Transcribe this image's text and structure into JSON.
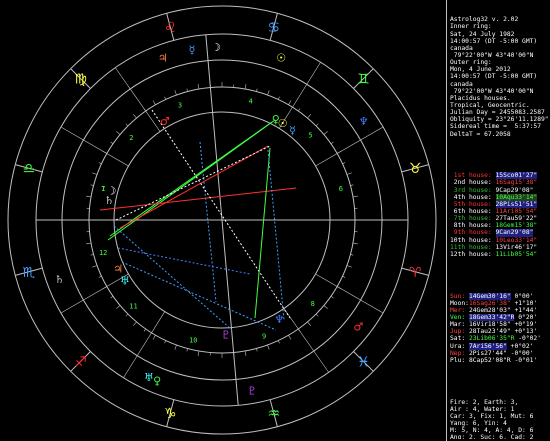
{
  "app": {
    "title": "Astrolog32 v. 2.02"
  },
  "header_lines": [
    {
      "text": "Astrolog32 v. 2.02",
      "color": "#ffffff"
    },
    {
      "text": "Inner ring:",
      "color": "#ffffff"
    },
    {
      "text": "Sat, 24 July 1982",
      "color": "#ffffff"
    },
    {
      "text": "14:00:57 (DT -5:00 GMT)",
      "color": "#ffffff"
    },
    {
      "text": "canada",
      "color": "#ffffff"
    },
    {
      "text": " 79°22'00\"W 43°40'00\"N",
      "color": "#ffffff"
    },
    {
      "text": "Outer ring:",
      "color": "#ffffff"
    },
    {
      "text": "Mon, 4 June 2012",
      "color": "#ffffff"
    },
    {
      "text": "14:00:57 (DT -5:00 GMT)",
      "color": "#ffffff"
    },
    {
      "text": "canada",
      "color": "#ffffff"
    },
    {
      "text": " 79°22'00\"W 43°40'00\"N",
      "color": "#ffffff"
    },
    {
      "text": "Placidus houses.",
      "color": "#ffffff"
    },
    {
      "text": "Tropical, Geocentric.",
      "color": "#ffffff"
    },
    {
      "text": "Julian Day = 2455083.2587",
      "color": "#ffffff"
    },
    {
      "text": "Obliquity = 23°26'11.1289\"",
      "color": "#ffffff"
    },
    {
      "text": "Sidereal time =  5:37:57",
      "color": "#ffffff"
    },
    {
      "text": "DeltaT = 67.2058",
      "color": "#ffffff"
    }
  ],
  "houses": [
    {
      "label": "1st house:",
      "label_color": "#ff3030",
      "value": "15Sco01'27\"",
      "value_color": "#ffffff",
      "bg": "#202080"
    },
    {
      "label": "2nd house:",
      "label_color": "#ffffff",
      "value": "16Sag15'38\"",
      "value_color": "#ff4040",
      "bg": ""
    },
    {
      "label": "3rd house:",
      "label_color": "#30c030",
      "value": "9Cap29'08\"",
      "value_color": "#ffffff",
      "bg": ""
    },
    {
      "label": "4th house:",
      "label_color": "#ffffff",
      "value": "10Aqu33'14\"",
      "value_color": "#40ff40",
      "bg": "#204020"
    },
    {
      "label": "5th house:",
      "label_color": "#ff3030",
      "value": "28Pis51'51\"",
      "value_color": "#ffffff",
      "bg": "#202080"
    },
    {
      "label": "6th house:",
      "label_color": "#ffffff",
      "value": "11Ari05'54\"",
      "value_color": "#ff4040",
      "bg": ""
    },
    {
      "label": "7th house:",
      "label_color": "#30c030",
      "value": "27Tau59'22\"",
      "value_color": "#ffffff",
      "bg": ""
    },
    {
      "label": "8th house:",
      "label_color": "#ffffff",
      "value": "18Gem15'38\"",
      "value_color": "#40ff40",
      "bg": ""
    },
    {
      "label": "9th house:",
      "label_color": "#ff3030",
      "value": "9Can29'08\"",
      "value_color": "#ffffff",
      "bg": "#202080"
    },
    {
      "label": "10th house:",
      "label_color": "#ffffff",
      "value": "10Leo33'14\"",
      "value_color": "#ff4040",
      "bg": ""
    },
    {
      "label": "11th house:",
      "label_color": "#30c030",
      "value": "13Vir46'17\"",
      "value_color": "#ffffff",
      "bg": ""
    },
    {
      "label": "12th house:",
      "label_color": "#ffffff",
      "value": "11Lib05'54\"",
      "value_color": "#40ff40",
      "bg": ""
    }
  ],
  "planets": [
    {
      "name": "Sun:",
      "name_color": "#ff4040",
      "value": "14Gem30'16\"",
      "value_color": "#ffffff",
      "bg": "#202080",
      "speed": " 0°00'"
    },
    {
      "name": "Moon:",
      "name_color": "#ffffff",
      "value": "16Sag26'38\"",
      "value_color": "#ff4040",
      "bg": "",
      "speed": " +1°10'"
    },
    {
      "name": "Mer:",
      "name_color": "#ff4040",
      "value": "24Gem28'03\"",
      "value_color": "#ffffff",
      "bg": "",
      "speed": " +1°44'"
    },
    {
      "name": "Ven:",
      "name_color": "#40ff40",
      "value": "18Gem33'42\"R",
      "value_color": "#ffffff",
      "bg": "#202080",
      "speed": " 0°20'"
    },
    {
      "name": "Mar:",
      "name_color": "#ffffff",
      "value": "16Vir18'58\"",
      "value_color": "#ffffff",
      "bg": "",
      "speed": " +0°19'"
    },
    {
      "name": "Jup:",
      "name_color": "#ff4040",
      "value": "28Tau23'49\"",
      "value_color": "#ffffff",
      "bg": "",
      "speed": " +0°13'"
    },
    {
      "name": "Sat:",
      "name_color": "#ffffff",
      "value": "23Lib06'35\"R",
      "value_color": "#40ff40",
      "bg": "",
      "speed": " -0°02'"
    },
    {
      "name": "Ura:",
      "name_color": "#ffffff",
      "value": "7Ari56'56\"",
      "value_color": "#ffffff",
      "bg": "#202080",
      "speed": " +0°02'"
    },
    {
      "name": "Nep:",
      "name_color": "#ff4040",
      "value": "2Pis27'44\"",
      "value_color": "#ffffff",
      "bg": "",
      "speed": " -0°00'"
    },
    {
      "name": "Plu:",
      "name_color": "#ffffff",
      "value": "8Cap52'08\"R",
      "value_color": "#ffffff",
      "bg": "",
      "speed": " -0°01'"
    }
  ],
  "summary_lines": [
    "Fire: 2, Earth: 3,",
    "Air : 4, Water: 1",
    "Car: 3, Fix: 1, Mut: 6",
    "Yang: 6, Yin: 4",
    "M: 5, N: 4, A: 4, D: 6",
    "Ang: 2, Suc: 6, Cad: 2",
    "Learn: 6, Share: 4"
  ],
  "wheel": {
    "ring_color": "#c0c0c0",
    "sign_glyphs": [
      {
        "name": "aries-icon",
        "glyph": "♈",
        "color": "#ff3030"
      },
      {
        "name": "taurus-icon",
        "glyph": "♉",
        "color": "#ffff40"
      },
      {
        "name": "gemini-icon",
        "glyph": "♊",
        "color": "#40ff40"
      },
      {
        "name": "cancer-icon",
        "glyph": "♋",
        "color": "#40a0ff"
      },
      {
        "name": "leo-icon",
        "glyph": "♌",
        "color": "#ff3030"
      },
      {
        "name": "virgo-icon",
        "glyph": "♍",
        "color": "#ffff40"
      },
      {
        "name": "libra-icon",
        "glyph": "♎",
        "color": "#40ff40"
      },
      {
        "name": "scorpio-icon",
        "glyph": "♏",
        "color": "#40a0ff"
      },
      {
        "name": "sagittarius-icon",
        "glyph": "♐",
        "color": "#ff3030"
      },
      {
        "name": "capricorn-icon",
        "glyph": "♑",
        "color": "#ffff40"
      },
      {
        "name": "aquarius-icon",
        "glyph": "♒",
        "color": "#40ff40"
      },
      {
        "name": "pisces-icon",
        "glyph": "♓",
        "color": "#40a0ff"
      }
    ],
    "house_numbers": [
      "1",
      "2",
      "3",
      "4",
      "5",
      "6",
      "7",
      "8",
      "9",
      "10",
      "11",
      "12"
    ],
    "inner_planets": [
      {
        "name": "sun-icon",
        "glyph": "☉",
        "color": "#ffff40"
      },
      {
        "name": "moon-icon",
        "glyph": "☽",
        "color": "#ffffff"
      },
      {
        "name": "mercury-icon",
        "glyph": "☿",
        "color": "#40a0ff"
      },
      {
        "name": "venus-icon",
        "glyph": "♀",
        "color": "#40ff40"
      },
      {
        "name": "mars-icon",
        "glyph": "♂",
        "color": "#ff3030"
      },
      {
        "name": "jupiter-icon",
        "glyph": "♃",
        "color": "#ff8040"
      },
      {
        "name": "saturn-icon",
        "glyph": "♄",
        "color": "#c0c0c0"
      },
      {
        "name": "uranus-icon",
        "glyph": "♅",
        "color": "#40ffff"
      },
      {
        "name": "neptune-icon",
        "glyph": "♆",
        "color": "#4080ff"
      },
      {
        "name": "pluto-icon",
        "glyph": "♇",
        "color": "#c040ff"
      }
    ]
  }
}
